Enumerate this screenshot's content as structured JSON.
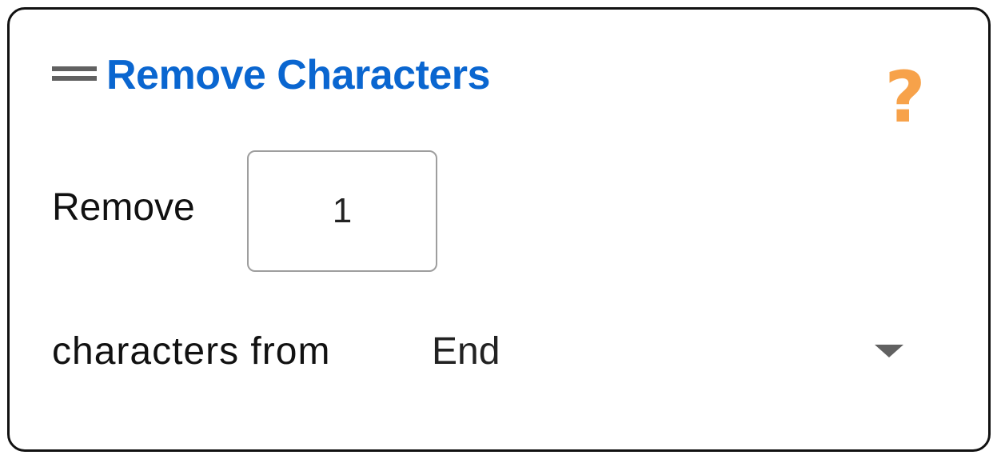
{
  "block": {
    "title": "Remove Characters",
    "help_glyph": "?"
  },
  "fields": {
    "remove_label": "Remove",
    "count_value": "1",
    "from_label": "characters from",
    "position_value": "End"
  },
  "icons": {
    "drag": "drag-handle-icon",
    "help": "help-icon",
    "dropdown": "caret-down-icon"
  },
  "colors": {
    "title": "#0a66d0",
    "help": "#f7a24a",
    "border": "#111111"
  }
}
